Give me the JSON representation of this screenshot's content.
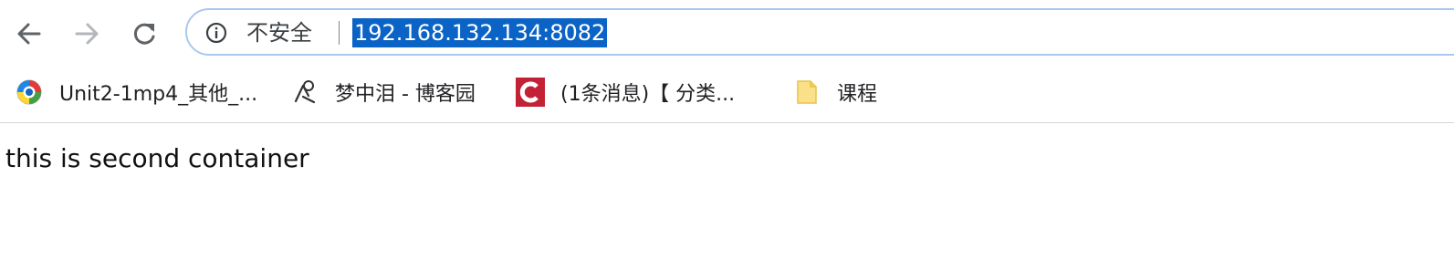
{
  "toolbar": {
    "back_icon": "arrow-left-icon",
    "forward_icon": "arrow-right-icon",
    "reload_icon": "reload-icon"
  },
  "omnibox": {
    "security_icon": "info-icon",
    "security_label": "不安全",
    "url": "192.168.132.134:8082",
    "selection_color": "#0b63c5"
  },
  "bookmarks": [
    {
      "label": "Unit2-1mp4_其他_...",
      "icon": "globe-app-icon"
    },
    {
      "label": "梦中泪 - 博客园",
      "icon": "cnblogs-logo-icon"
    },
    {
      "label": "(1条消息)【 分类...",
      "icon": "csdn-logo-icon"
    },
    {
      "label": "课程",
      "icon": "folder-icon"
    }
  ],
  "page": {
    "content_text": "this is second container"
  }
}
